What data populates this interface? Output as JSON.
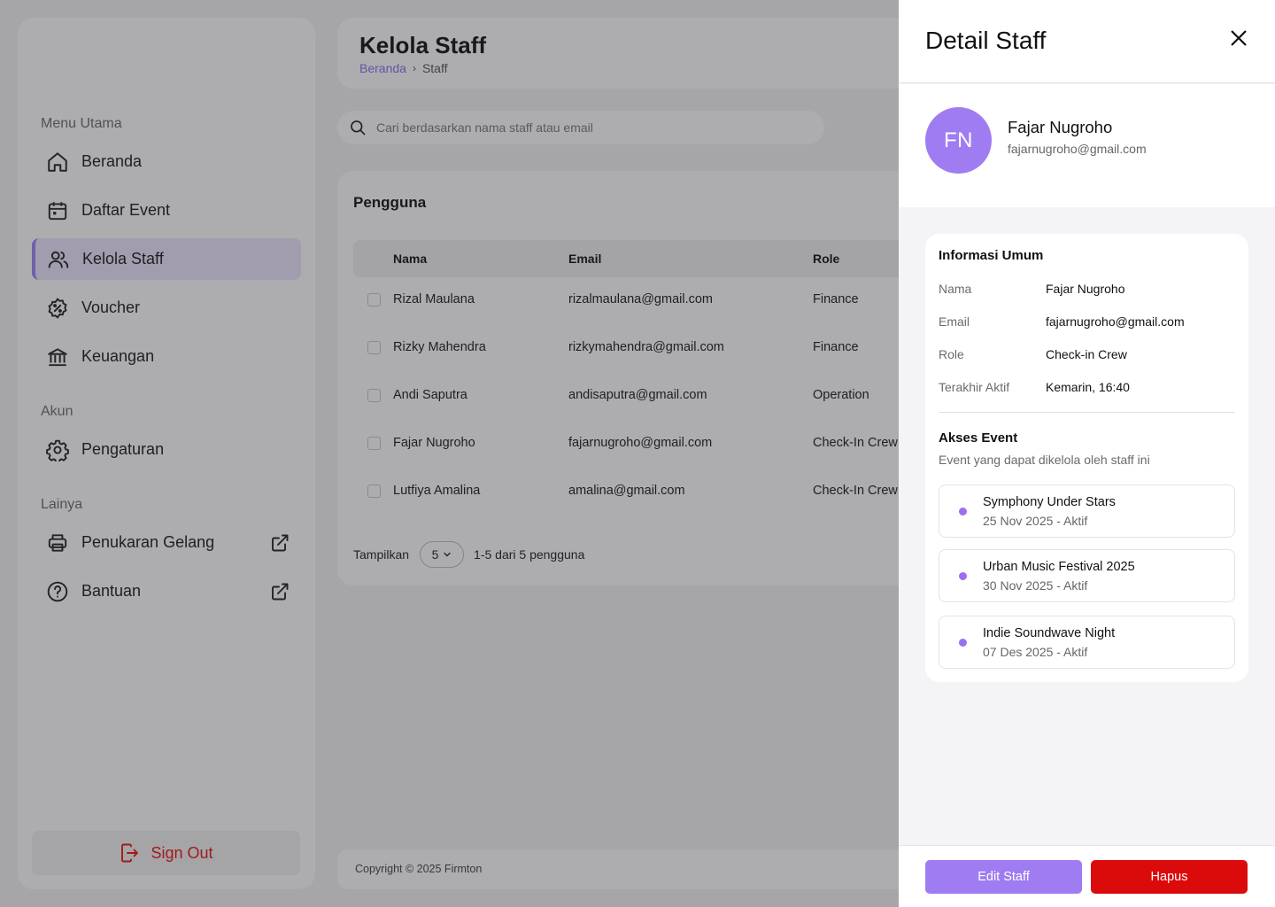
{
  "sidebar": {
    "section_main": "Menu Utama",
    "section_account": "Akun",
    "section_other": "Lainya",
    "items": [
      {
        "label": "Beranda",
        "icon": "home-icon"
      },
      {
        "label": "Daftar Event",
        "icon": "calendar-icon"
      },
      {
        "label": "Kelola Staff",
        "icon": "users-icon",
        "active": true
      },
      {
        "label": "Voucher",
        "icon": "discount-badge-icon"
      },
      {
        "label": "Keuangan",
        "icon": "bank-icon"
      },
      {
        "label": "Pengaturan",
        "icon": "gear-icon"
      },
      {
        "label": "Penukaran Gelang",
        "icon": "printer-icon",
        "external": true
      },
      {
        "label": "Bantuan",
        "icon": "help-circle-icon",
        "external": true
      }
    ],
    "signout_label": "Sign Out"
  },
  "header": {
    "title": "Kelola Staff",
    "breadcrumb": [
      "Beranda",
      "Staff"
    ]
  },
  "search": {
    "placeholder": "Cari berdasarkan nama staff atau email",
    "value": ""
  },
  "table": {
    "title": "Pengguna",
    "columns": [
      "Nama",
      "Email",
      "Role"
    ],
    "rows": [
      {
        "name": "Rizal Maulana",
        "email": "rizalmaulana@gmail.com",
        "role": "Finance"
      },
      {
        "name": "Rizky Mahendra",
        "email": "rizkymahendra@gmail.com",
        "role": "Finance"
      },
      {
        "name": "Andi Saputra",
        "email": "andisaputra@gmail.com",
        "role": "Operation"
      },
      {
        "name": "Fajar Nugroho",
        "email": "fajarnugroho@gmail.com",
        "role": "Check-In Crew"
      },
      {
        "name": "Lutfiya Amalina",
        "email": "amalina@gmail.com",
        "role": "Check-In Crew"
      }
    ],
    "footer": {
      "show_label": "Tampilkan",
      "page_size": "5",
      "range_text": "1-5 dari 5 pengguna"
    }
  },
  "footer": {
    "copyright": "Copyright © 2025 Firmton"
  },
  "drawer": {
    "title": "Detail Staff",
    "profile": {
      "initials": "FN",
      "name": "Fajar Nugroho",
      "email": "fajarnugroho@gmail.com"
    },
    "info_title": "Informasi Umum",
    "info": [
      {
        "key": "Nama",
        "value": "Fajar Nugroho"
      },
      {
        "key": "Email",
        "value": "fajarnugroho@gmail.com"
      },
      {
        "key": "Role",
        "value": "Check-in Crew"
      },
      {
        "key": "Terakhir Aktif",
        "value": "Kemarin, 16:40"
      }
    ],
    "access_title": "Akses Event",
    "access_subtitle": "Event yang dapat dikelola oleh staff ini",
    "events": [
      {
        "name": "Symphony Under Stars",
        "date_status": "25 Nov 2025 - Aktif"
      },
      {
        "name": "Urban Music Festival 2025",
        "date_status": "30 Nov 2025 - Aktif"
      },
      {
        "name": "Indie Soundwave Night",
        "date_status": "07 Des 2025 - Aktif"
      }
    ],
    "edit_label": "Edit Staff",
    "delete_label": "Hapus"
  },
  "colors": {
    "accent": "#a07cf2",
    "danger": "#dc0b0b",
    "overlay": "#28282c"
  }
}
